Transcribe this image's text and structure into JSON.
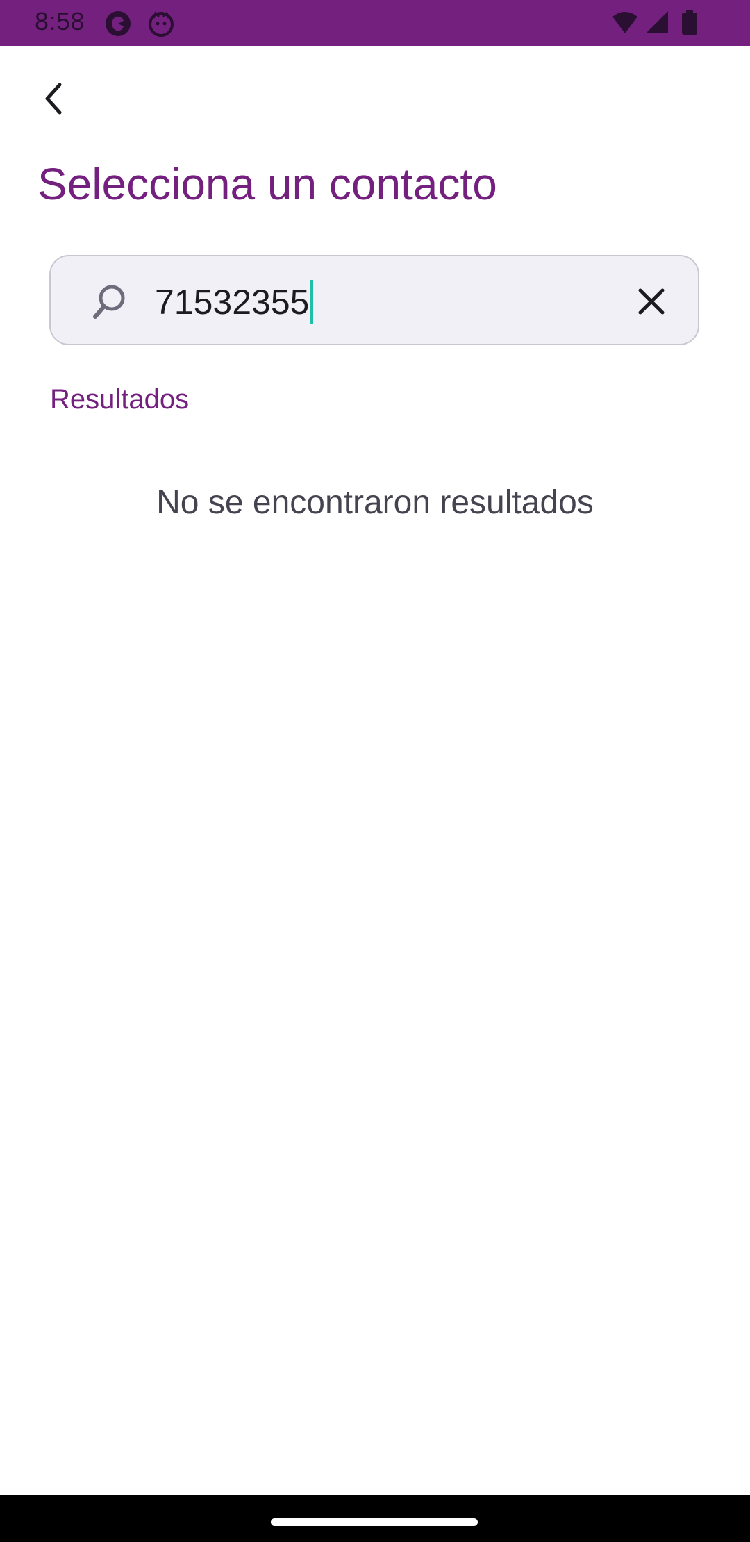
{
  "status_bar": {
    "time": "8:58",
    "icons": [
      "app-notification-icon",
      "cat-notification-icon",
      "wifi-icon",
      "signal-icon",
      "battery-icon"
    ],
    "background_color": "#74207f"
  },
  "header": {
    "back_icon": "chevron-left-icon",
    "title": "Selecciona un contacto"
  },
  "search": {
    "value": "71532355",
    "icon": "search-icon",
    "clear_icon": "close-icon"
  },
  "results": {
    "label": "Resultados",
    "empty_message": "No se encontraron resultados"
  },
  "colors": {
    "accent": "#74207f",
    "caret": "#1fbfa8",
    "field_background": "#f1f0f6"
  }
}
